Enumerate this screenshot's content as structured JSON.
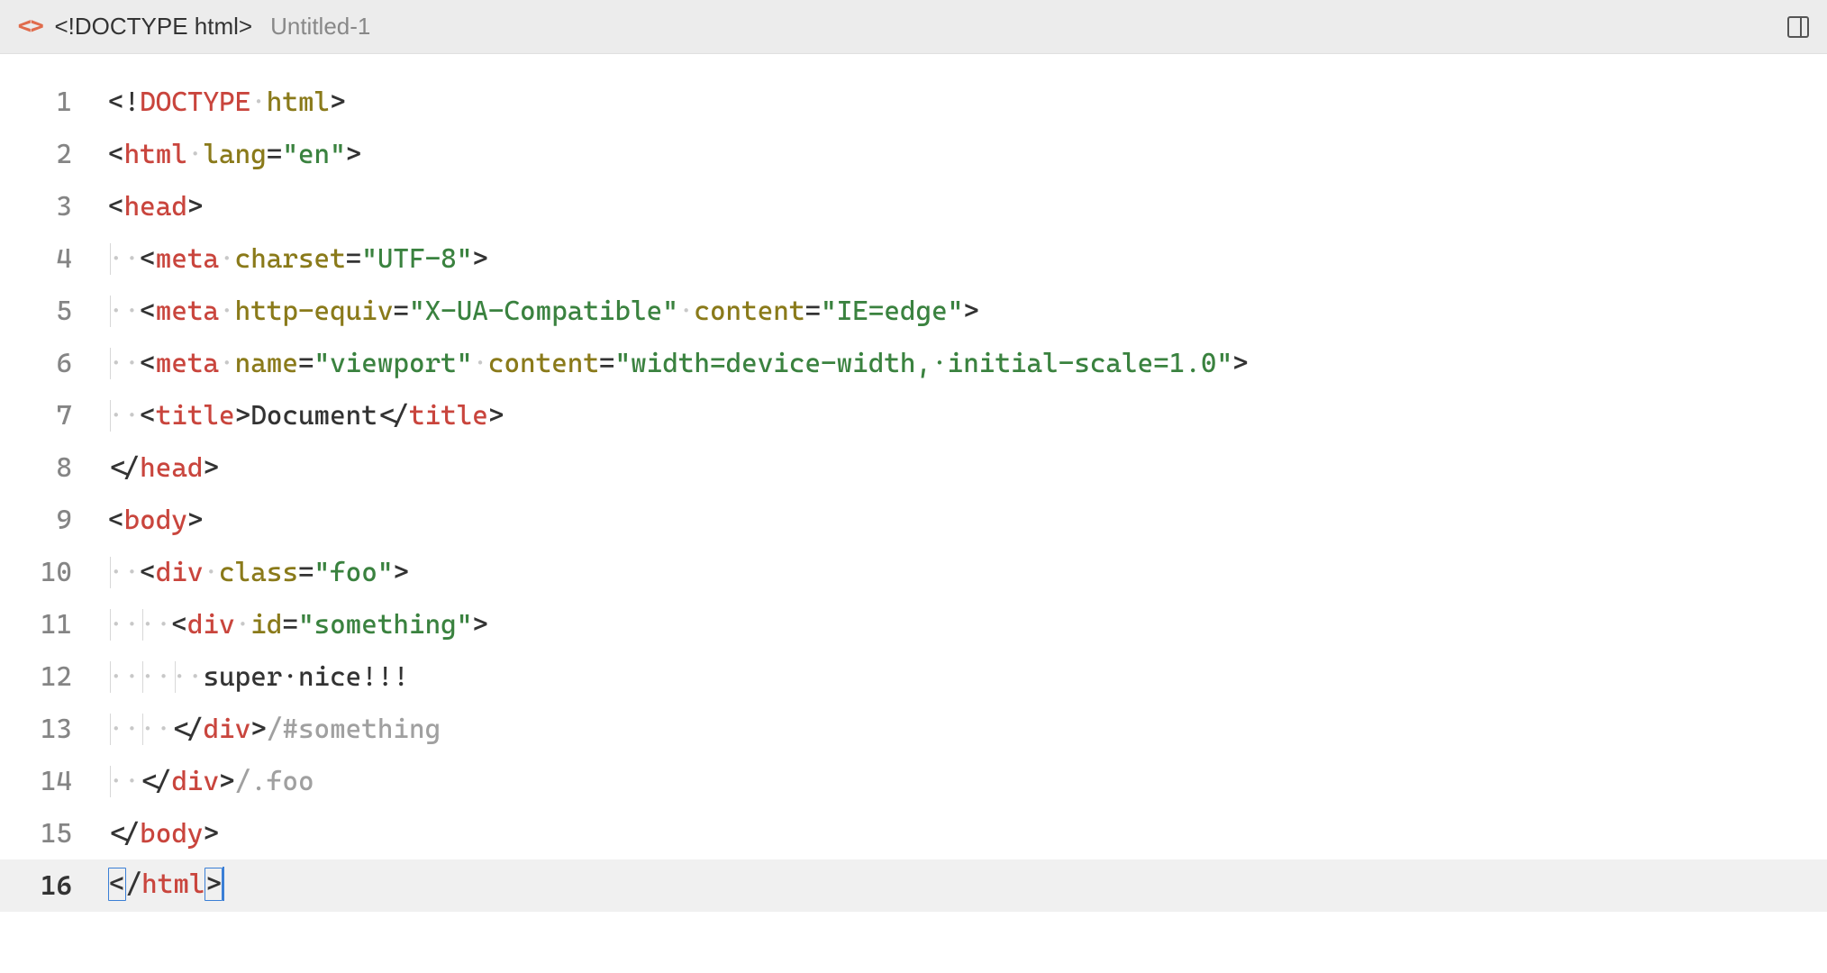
{
  "tab": {
    "title": "<!DOCTYPE html>",
    "filename": "Untitled-1"
  },
  "lines": [
    {
      "num": "1",
      "tokens": [
        {
          "t": "<",
          "c": "punct"
        },
        {
          "t": "!",
          "c": "punct"
        },
        {
          "t": "DOCTYPE",
          "c": "doctype"
        },
        {
          "t": "·",
          "c": "ws"
        },
        {
          "t": "html",
          "c": "attr"
        },
        {
          "t": ">",
          "c": "punct"
        }
      ]
    },
    {
      "num": "2",
      "tokens": [
        {
          "t": "<",
          "c": "punct"
        },
        {
          "t": "html",
          "c": "tag"
        },
        {
          "t": "·",
          "c": "ws"
        },
        {
          "t": "lang",
          "c": "attr"
        },
        {
          "t": "=",
          "c": "punct"
        },
        {
          "t": "\"en\"",
          "c": "string"
        },
        {
          "t": ">",
          "c": "punct"
        }
      ]
    },
    {
      "num": "3",
      "tokens": [
        {
          "t": "<",
          "c": "punct"
        },
        {
          "t": "head",
          "c": "tag"
        },
        {
          "t": ">",
          "c": "punct"
        }
      ]
    },
    {
      "num": "4",
      "guides": [
        0
      ],
      "tokens": [
        {
          "t": "··",
          "c": "ws"
        },
        {
          "t": "<",
          "c": "punct"
        },
        {
          "t": "meta",
          "c": "tag"
        },
        {
          "t": "·",
          "c": "ws"
        },
        {
          "t": "charset",
          "c": "attr"
        },
        {
          "t": "=",
          "c": "punct"
        },
        {
          "t": "\"UTF-8\"",
          "c": "string"
        },
        {
          "t": ">",
          "c": "punct"
        }
      ]
    },
    {
      "num": "5",
      "guides": [
        0
      ],
      "tokens": [
        {
          "t": "··",
          "c": "ws"
        },
        {
          "t": "<",
          "c": "punct"
        },
        {
          "t": "meta",
          "c": "tag"
        },
        {
          "t": "·",
          "c": "ws"
        },
        {
          "t": "http-equiv",
          "c": "attr"
        },
        {
          "t": "=",
          "c": "punct"
        },
        {
          "t": "\"X-UA-Compatible\"",
          "c": "string"
        },
        {
          "t": "·",
          "c": "ws"
        },
        {
          "t": "content",
          "c": "attr"
        },
        {
          "t": "=",
          "c": "punct"
        },
        {
          "t": "\"IE=edge\"",
          "c": "string"
        },
        {
          "t": ">",
          "c": "punct"
        }
      ]
    },
    {
      "num": "6",
      "guides": [
        0
      ],
      "tokens": [
        {
          "t": "··",
          "c": "ws"
        },
        {
          "t": "<",
          "c": "punct"
        },
        {
          "t": "meta",
          "c": "tag"
        },
        {
          "t": "·",
          "c": "ws"
        },
        {
          "t": "name",
          "c": "attr"
        },
        {
          "t": "=",
          "c": "punct"
        },
        {
          "t": "\"viewport\"",
          "c": "string"
        },
        {
          "t": "·",
          "c": "ws"
        },
        {
          "t": "content",
          "c": "attr"
        },
        {
          "t": "=",
          "c": "punct"
        },
        {
          "t": "\"width=device-width,·initial-scale=1.0\"",
          "c": "string"
        },
        {
          "t": ">",
          "c": "punct"
        }
      ]
    },
    {
      "num": "7",
      "guides": [
        0
      ],
      "tokens": [
        {
          "t": "··",
          "c": "ws"
        },
        {
          "t": "<",
          "c": "punct"
        },
        {
          "t": "title",
          "c": "tag"
        },
        {
          "t": ">",
          "c": "punct"
        },
        {
          "t": "Document",
          "c": "text"
        },
        {
          "t": "</",
          "c": "punct"
        },
        {
          "t": "title",
          "c": "tag"
        },
        {
          "t": ">",
          "c": "punct"
        }
      ]
    },
    {
      "num": "8",
      "tokens": [
        {
          "t": "</",
          "c": "punct"
        },
        {
          "t": "head",
          "c": "tag"
        },
        {
          "t": ">",
          "c": "punct"
        }
      ]
    },
    {
      "num": "9",
      "tokens": [
        {
          "t": "<",
          "c": "punct"
        },
        {
          "t": "body",
          "c": "tag"
        },
        {
          "t": ">",
          "c": "punct"
        }
      ]
    },
    {
      "num": "10",
      "guides": [
        0
      ],
      "tokens": [
        {
          "t": "··",
          "c": "ws"
        },
        {
          "t": "<",
          "c": "punct"
        },
        {
          "t": "div",
          "c": "tag"
        },
        {
          "t": "·",
          "c": "ws"
        },
        {
          "t": "class",
          "c": "attr"
        },
        {
          "t": "=",
          "c": "punct"
        },
        {
          "t": "\"foo\"",
          "c": "string"
        },
        {
          "t": ">",
          "c": "punct"
        }
      ]
    },
    {
      "num": "11",
      "guides": [
        0,
        2
      ],
      "tokens": [
        {
          "t": "····",
          "c": "ws"
        },
        {
          "t": "<",
          "c": "punct"
        },
        {
          "t": "div",
          "c": "tag"
        },
        {
          "t": "·",
          "c": "ws"
        },
        {
          "t": "id",
          "c": "attr"
        },
        {
          "t": "=",
          "c": "punct"
        },
        {
          "t": "\"something\"",
          "c": "string"
        },
        {
          "t": ">",
          "c": "punct"
        }
      ]
    },
    {
      "num": "12",
      "guides": [
        0,
        2,
        4
      ],
      "tokens": [
        {
          "t": "······",
          "c": "ws"
        },
        {
          "t": "super·nice!!!",
          "c": "text"
        }
      ]
    },
    {
      "num": "13",
      "guides": [
        0,
        2
      ],
      "tokens": [
        {
          "t": "····",
          "c": "ws"
        },
        {
          "t": "</",
          "c": "punct"
        },
        {
          "t": "div",
          "c": "tag"
        },
        {
          "t": ">",
          "c": "punct"
        },
        {
          "t": "/#something",
          "c": "comment"
        }
      ]
    },
    {
      "num": "14",
      "guides": [
        0
      ],
      "tokens": [
        {
          "t": "··",
          "c": "ws"
        },
        {
          "t": "</",
          "c": "punct"
        },
        {
          "t": "div",
          "c": "tag"
        },
        {
          "t": ">",
          "c": "punct"
        },
        {
          "t": "/.foo",
          "c": "comment"
        }
      ]
    },
    {
      "num": "15",
      "tokens": [
        {
          "t": "</",
          "c": "punct"
        },
        {
          "t": "body",
          "c": "tag"
        },
        {
          "t": ">",
          "c": "punct"
        }
      ]
    },
    {
      "num": "16",
      "current": true,
      "tokens": [
        {
          "t": "<",
          "c": "punct bracket-hl"
        },
        {
          "t": "/",
          "c": "punct"
        },
        {
          "t": "html",
          "c": "tag"
        },
        {
          "t": ">",
          "c": "punct bracket-hl"
        },
        {
          "t": "",
          "c": "cursor-marker"
        }
      ]
    }
  ]
}
